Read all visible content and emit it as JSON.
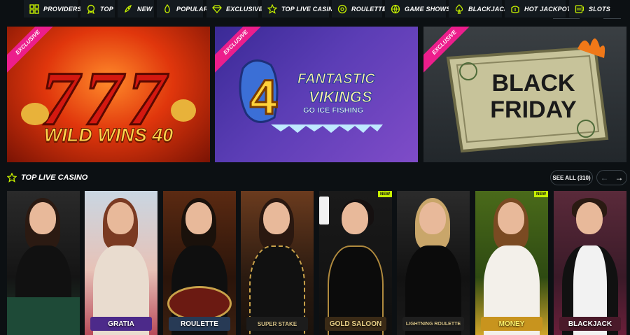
{
  "nav": {
    "items": [
      {
        "label": "PROVIDERS",
        "icon": "grid-icon"
      },
      {
        "label": "TOP",
        "icon": "medal-icon"
      },
      {
        "label": "NEW",
        "icon": "rocket-icon"
      },
      {
        "label": "POPULAR",
        "icon": "flame-icon"
      },
      {
        "label": "EXCLUSIVE",
        "icon": "diamond-icon"
      },
      {
        "label": "TOP LIVE CASINO",
        "icon": "star-icon"
      },
      {
        "label": "ROULETTE",
        "icon": "roulette-icon"
      },
      {
        "label": "GAME SHOWS",
        "icon": "ball-icon"
      },
      {
        "label": "BLACKJACK",
        "icon": "spade-icon"
      },
      {
        "label": "HOT JACKPOTS",
        "icon": "money-icon"
      },
      {
        "label": "SLOTS",
        "icon": "slots-icon"
      }
    ]
  },
  "banners": [
    {
      "badge": "EXCLUSIVE",
      "title": "WILD WINS 40"
    },
    {
      "badge": "EXCLUSIVE",
      "title_line1": "FANTASTIC",
      "title_line2": "VIKINGS",
      "subtitle": "GO ICE FISHING"
    },
    {
      "badge": "EXCLUSIVE",
      "title_line1": "BLACK",
      "title_line2": "FRIDAY"
    }
  ],
  "section": {
    "title": "TOP LIVE CASINO",
    "see_all": "SEE ALL (310)"
  },
  "tiles": [
    {
      "label": "",
      "badge": ""
    },
    {
      "label": "GRATIA",
      "badge": ""
    },
    {
      "label": "ROULETTE",
      "badge": ""
    },
    {
      "label": "SUPER STAKE",
      "badge": ""
    },
    {
      "label": "GOLD SALOON",
      "badge": "NEW"
    },
    {
      "label": "LIGHTNING ROULETTE",
      "badge": ""
    },
    {
      "label": "MONEY",
      "badge": "NEW"
    },
    {
      "label": "BLACKJACK",
      "badge": ""
    }
  ],
  "colors": {
    "accent": "#c6f000",
    "exclusive": "#ec1e8c"
  }
}
